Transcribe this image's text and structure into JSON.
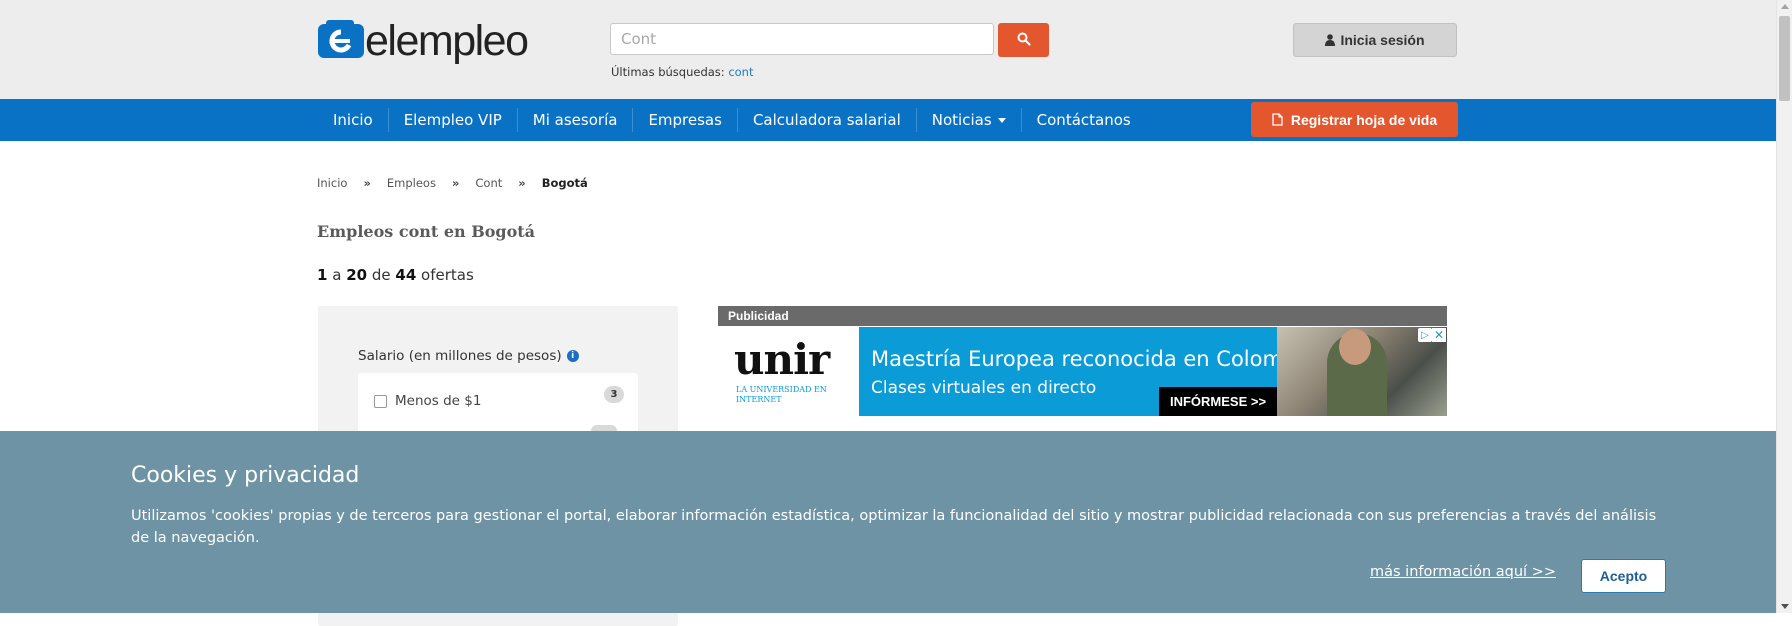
{
  "header": {
    "logo_text": "elempleo",
    "search": {
      "value": "",
      "placeholder": "Cont"
    },
    "recent_label": "Últimas búsquedas:",
    "recent_link": "cont",
    "login_label": "Inicia sesión"
  },
  "nav": {
    "items": [
      {
        "label": "Inicio"
      },
      {
        "label": "Elempleo VIP"
      },
      {
        "label": "Mi asesoría"
      },
      {
        "label": "Empresas"
      },
      {
        "label": "Calculadora salarial"
      },
      {
        "label": "Noticias"
      },
      {
        "label": "Contáctanos"
      }
    ],
    "register_label": "Registrar hoja de vida"
  },
  "breadcrumb": {
    "items": [
      "Inicio",
      "Empleos",
      "Cont",
      "Bogotá"
    ],
    "separator": "»"
  },
  "main": {
    "title": "Empleos cont en Bogotá",
    "results": {
      "from": "1",
      "a": "a",
      "to": "20",
      "de": "de",
      "total": "44",
      "suffix": "ofertas"
    }
  },
  "filters": {
    "salary_title": "Salario (en millones de pesos)",
    "options": [
      {
        "label": "Menos de $1",
        "count": "3"
      }
    ]
  },
  "ad": {
    "label": "Publicidad",
    "brand": "unir",
    "brand_sub": "LA UNIVERSIDAD EN INTERNET",
    "headline": "Maestría Europea reconocida en Colombia",
    "subline": "Clases virtuales en directo",
    "cta": "INFÓRMESE >>"
  },
  "cookies": {
    "title": "Cookies y privacidad",
    "text": "Utilizamos 'cookies' propias y de terceros para gestionar el portal, elaborar información estadística, optimizar la funcionalidad del sitio y mostrar publicidad relacionada con sus preferencias a través del análisis de la navegación.",
    "more_link": "más información aquí >>",
    "accept_label": "Acepto"
  },
  "colors": {
    "brand_blue": "#0a72c5",
    "accent_orange": "#e4572e",
    "cookie_bg": "#6d93a5"
  }
}
